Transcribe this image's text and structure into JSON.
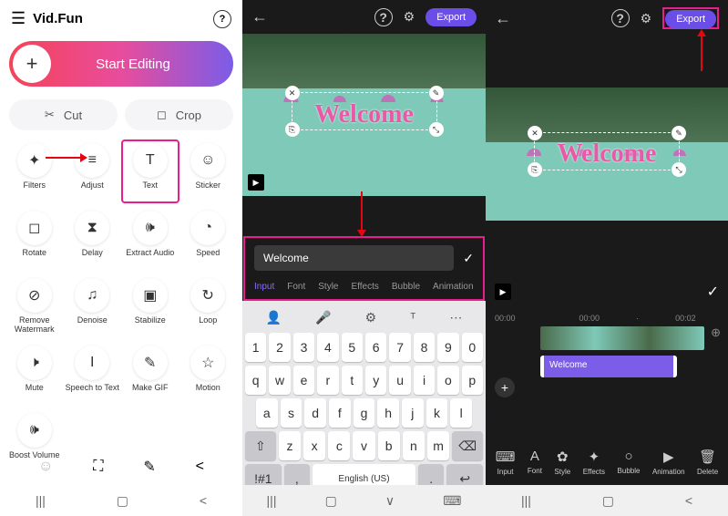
{
  "panel1": {
    "app_name": "Vid.Fun",
    "start_editing": "Start Editing",
    "cut": "Cut",
    "crop": "Crop",
    "tools": [
      {
        "label": "Filters",
        "icon": "✦"
      },
      {
        "label": "Adjust",
        "icon": "≡"
      },
      {
        "label": "Text",
        "icon": "T",
        "hl": true
      },
      {
        "label": "Sticker",
        "icon": "☺"
      },
      {
        "label": "Rotate",
        "icon": "◻"
      },
      {
        "label": "Delay",
        "icon": "⧗"
      },
      {
        "label": "Extract Audio",
        "icon": "🕪"
      },
      {
        "label": "Speed",
        "icon": "◔"
      },
      {
        "label": "Remove Watermark",
        "icon": "⊘"
      },
      {
        "label": "Denoise",
        "icon": "♫"
      },
      {
        "label": "Stabilize",
        "icon": "▣"
      },
      {
        "label": "Loop",
        "icon": "↻"
      },
      {
        "label": "Mute",
        "icon": "🕨"
      },
      {
        "label": "Speech to Text",
        "icon": "I"
      },
      {
        "label": "Make GIF",
        "icon": "✎"
      },
      {
        "label": "Motion",
        "icon": "☆"
      },
      {
        "label": "Boost Volume",
        "icon": "🕪"
      }
    ]
  },
  "panel2": {
    "export": "Export",
    "preview_text": "Welcome",
    "input_value": "Welcome",
    "tabs": [
      "Input",
      "Font",
      "Style",
      "Effects",
      "Bubble",
      "Animation"
    ],
    "keyboard": {
      "row1": [
        "1",
        "2",
        "3",
        "4",
        "5",
        "6",
        "7",
        "8",
        "9",
        "0"
      ],
      "row2": [
        "q",
        "w",
        "e",
        "r",
        "t",
        "y",
        "u",
        "i",
        "o",
        "p"
      ],
      "row3": [
        "a",
        "s",
        "d",
        "f",
        "g",
        "h",
        "j",
        "k",
        "l"
      ],
      "row4": [
        "z",
        "x",
        "c",
        "v",
        "b",
        "n",
        "m"
      ],
      "shift": "⇧",
      "bksp": "⌫",
      "sym": "!#1",
      "comma": ",",
      "lang": "English (US)",
      "period": ".",
      "enter": "↩"
    }
  },
  "panel3": {
    "export": "Export",
    "preview_text": "Welcome",
    "time_start": "00:00",
    "time_t1": "00:00",
    "time_t2": "00:02",
    "clip_label": "Welcome",
    "tools": [
      {
        "label": "Input",
        "icon": "⌨"
      },
      {
        "label": "Font",
        "icon": "A"
      },
      {
        "label": "Style",
        "icon": "✿"
      },
      {
        "label": "Effects",
        "icon": "✦"
      },
      {
        "label": "Bubble",
        "icon": "○"
      },
      {
        "label": "Animation",
        "icon": "▶"
      },
      {
        "label": "Delete",
        "icon": "🗑"
      }
    ]
  }
}
